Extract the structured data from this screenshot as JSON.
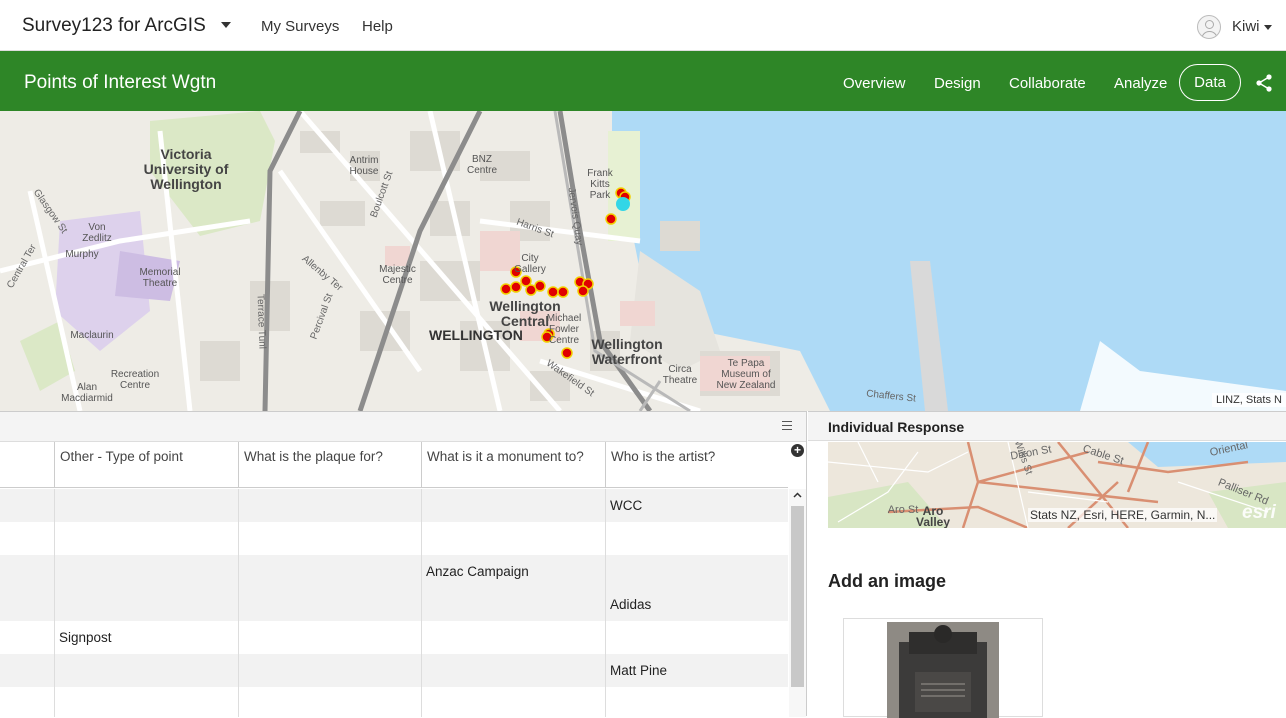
{
  "app": {
    "title": "Survey123 for ArcGIS"
  },
  "nav": {
    "my_surveys": "My Surveys",
    "help": "Help"
  },
  "user": {
    "name": "Kiwi"
  },
  "survey": {
    "title": "Points of Interest Wgtn",
    "tabs": {
      "overview": "Overview",
      "design": "Design",
      "collaborate": "Collaborate",
      "analyze": "Analyze",
      "data": "Data"
    }
  },
  "map": {
    "labels": {
      "victoria": "Victoria University of Wellington",
      "antrim": "Antrim House",
      "bnz": "BNZ Centre",
      "frank_kitts": "Frank Kitts Park",
      "von_zedlitz": "Von Zedlitz",
      "murphy": "Murphy",
      "memorial_theatre": "Memorial Theatre",
      "maclaurin": "Maclaurin",
      "recreation": "Recreation Centre",
      "alan_macdiarmid": "Alan Macdiarmid",
      "majestic": "Majestic Centre",
      "city_gallery": "City Gallery",
      "wellington_central": "Wellington Central",
      "wellington": "WELLINGTON",
      "michael_fowler": "Michael Fowler Centre",
      "waterfront": "Wellington Waterfront",
      "circa": "Circa Theatre",
      "te_papa": "Te Papa Museum of New Zealand",
      "harris_st": "Harris St",
      "jervois_quay": "Jervois Quay",
      "boulcott_st": "Boulcott St",
      "allenby_ter": "Allenby Ter",
      "percival_st": "Percival St",
      "terrace_tunl": "Terrace Tunl",
      "wakefield_st": "Wakefield St",
      "chaffers_st": "Chaffers St",
      "glasgow_st": "Glasgow St",
      "central_ter": "Central Ter"
    },
    "attribution": "LINZ, Stats N"
  },
  "table": {
    "columns": [
      "Other - Type of point",
      "What is the plaque for?",
      "What is it a monument to?",
      "Who is the artist?"
    ],
    "rows": [
      [
        "",
        "",
        "",
        "WCC"
      ],
      [
        "",
        "",
        "",
        ""
      ],
      [
        "",
        "",
        "Anzac Campaign",
        ""
      ],
      [
        "",
        "",
        "",
        "Adidas"
      ],
      [
        "Signpost",
        "",
        "",
        ""
      ],
      [
        "",
        "",
        "",
        "Matt Pine"
      ],
      [
        "",
        "",
        "",
        ""
      ]
    ]
  },
  "response": {
    "title": "Individual Response",
    "mini_map": {
      "streets": [
        "Dixon St",
        "Cable St",
        "Willis St",
        "Oriental",
        "Palliser Rd",
        "Aro St",
        "Aro Valley"
      ],
      "attribution": "Stats NZ, Esri, HERE, Garmin, N...",
      "logo": "esri"
    },
    "image_section": "Add an image"
  },
  "colors": {
    "brand_green": "#2e8627",
    "point_fill": "#e00000",
    "point_outline": "#f2d000",
    "selected_point": "#33d6e6",
    "water": "#aedaf6"
  }
}
